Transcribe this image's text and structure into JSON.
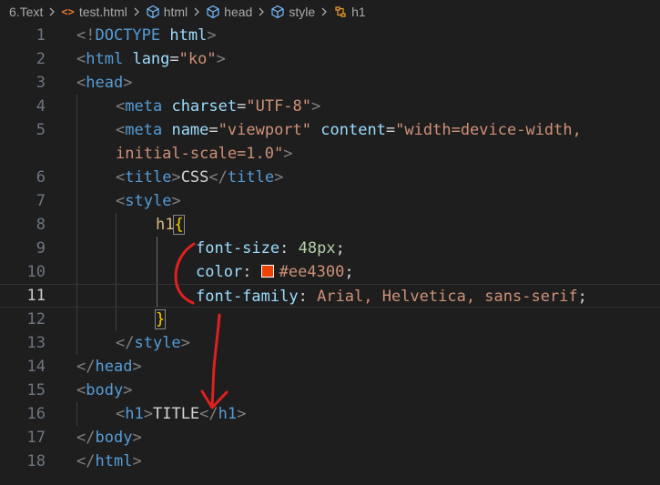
{
  "breadcrumb": {
    "items": [
      {
        "label": "6.Text",
        "icon": ""
      },
      {
        "label": "test.html",
        "icon": "html-file-icon"
      },
      {
        "label": "html",
        "icon": "element-icon"
      },
      {
        "label": "head",
        "icon": "element-icon"
      },
      {
        "label": "style",
        "icon": "element-icon"
      },
      {
        "label": "h1",
        "icon": "css-selector-icon"
      }
    ],
    "separator_icon": "chevron-right-icon"
  },
  "editor": {
    "active_line": 11,
    "line_numbers": [
      "1",
      "2",
      "3",
      "4",
      "5",
      "",
      "6",
      "7",
      "8",
      "9",
      "10",
      "11",
      "12",
      "13",
      "14",
      "15",
      "16",
      "17",
      "18"
    ],
    "color_swatch": "#ee4300",
    "lines": {
      "l1": {
        "lt": "<!",
        "tag": "DOCTYPE",
        "attr": "html",
        "gt": ">"
      },
      "l2": {
        "lt": "<",
        "tag": "html",
        "attr": "lang",
        "eq": "=",
        "val": "\"ko\"",
        "gt": ">"
      },
      "l3": {
        "lt": "<",
        "tag": "head",
        "gt": ">"
      },
      "l4": {
        "lt": "<",
        "tag": "meta",
        "attr": "charset",
        "eq": "=",
        "val": "\"UTF-8\"",
        "gt": ">"
      },
      "l5": {
        "lt": "<",
        "tag": "meta",
        "attr1": "name",
        "eq1": "=",
        "val1": "\"viewport\"",
        "attr2": "content",
        "eq2": "=",
        "val2": "\"width=device-width,"
      },
      "l5b": {
        "val": "initial-scale=1.0\"",
        "gt": ">"
      },
      "l6": {
        "lt": "<",
        "tag": "title",
        "gt": ">",
        "text": "CSS",
        "lt2": "</",
        "tag2": "title",
        "gt2": ">"
      },
      "l7": {
        "lt": "<",
        "tag": "style",
        "gt": ">"
      },
      "l8": {
        "sel": "h1",
        "brace": "{"
      },
      "l9": {
        "prop": "font-size",
        "colon": ": ",
        "num": "48px",
        "semi": ";"
      },
      "l10": {
        "prop": "color",
        "colon": ": ",
        "val": "#ee4300",
        "semi": ";"
      },
      "l11": {
        "prop": "font-family",
        "colon": ": ",
        "val": "Arial, Helvetica, sans-serif",
        "semi": ";"
      },
      "l12": {
        "brace": "}"
      },
      "l13": {
        "lt": "</",
        "tag": "style",
        "gt": ">"
      },
      "l14": {
        "lt": "</",
        "tag": "head",
        "gt": ">"
      },
      "l15": {
        "lt": "<",
        "tag": "body",
        "gt": ">"
      },
      "l16": {
        "lt": "<",
        "tag": "h1",
        "gt": ">",
        "text": "TITLE",
        "lt2": "</",
        "tag2": "h1",
        "gt2": ">"
      },
      "l17": {
        "lt": "</",
        "tag": "body",
        "gt": ">"
      },
      "l18": {
        "lt": "</",
        "tag": "html",
        "gt": ">"
      }
    }
  },
  "annotation": {
    "color": "#e02020"
  }
}
